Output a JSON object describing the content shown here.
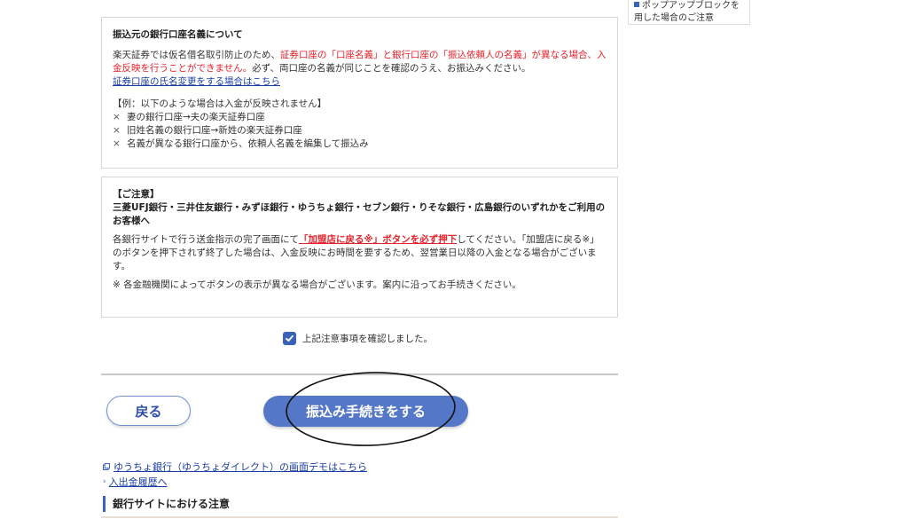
{
  "sidebar": {
    "cut_line": "ポップアップブロックを",
    "line": "用した場合のご注意"
  },
  "box1": {
    "title": "振込元の銀行口座名義について",
    "para1_a": "楽天証券では仮名借名取引防止のため、",
    "para1_red": "証券口座の「口座名義」と銀行口座の「振込依頼人の名義」が異なる場合、入金反映を行うことができません。",
    "para1_b": "必ず、両口座の名義が同じことを確認のうえ、お振込みください。",
    "link": "証券口座の氏名変更をする場合はこちら",
    "example_title": "【例：以下のような場合は入金が反映されません】",
    "examples": [
      "妻の銀行口座→夫の楽天証券口座",
      "旧姓名義の銀行口座→新姓の楽天証券口座",
      "名義が異なる銀行口座から、依頼人名義を編集して振込み"
    ],
    "x_mark": "×"
  },
  "box2": {
    "title": "【ご注意】",
    "bold_line": "三菱UFJ銀行・三井住友銀行・みずほ銀行・ゆうちょ銀行・セブン銀行・りそな銀行・広島銀行のいずれかをご利用のお客様へ",
    "para_a": "各銀行サイトで行う送金指示の完了画面にて",
    "para_red_link": "「加盟店に戻る※」ボタンを必ず押下",
    "para_b": "してください。「加盟店に戻る※」のボタンを押下されず終了した場合は、入金反映にお時間を要するため、翌営業日以降の入金となる場合がございます。",
    "note": "※ 各金融機関によってボタンの表示が異なる場合がございます。案内に沿ってお手続きください。"
  },
  "confirm": {
    "label": "上記注意事項を確認しました。",
    "checked": true
  },
  "buttons": {
    "back": "戻る",
    "submit": "振込み手続きをする"
  },
  "links": {
    "demo": "ゆうちょ銀行（ゆうちょダイレクト）の画面デモはこちら",
    "history": "入出金履歴へ"
  },
  "section": {
    "title": "銀行サイトにおける注意"
  },
  "colors": {
    "accent": "#3b62b9",
    "primary_button": "#5577c7",
    "warning": "#e8222b",
    "link": "#1a3fa4"
  }
}
